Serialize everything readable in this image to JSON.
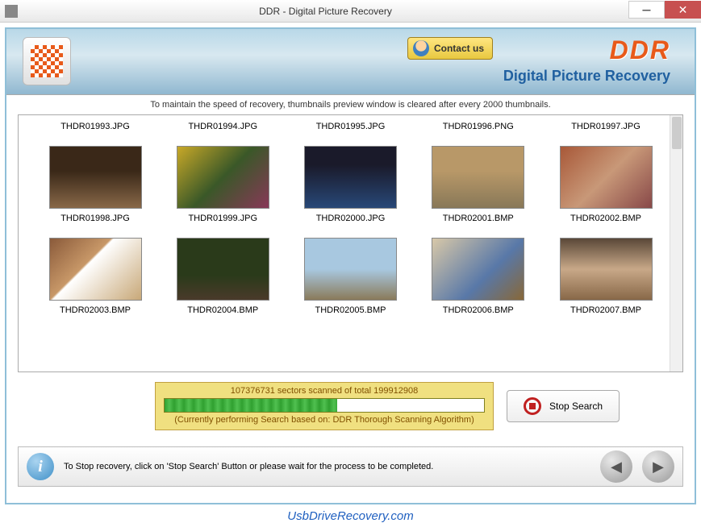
{
  "titlebar": {
    "title": "DDR - Digital Picture Recovery"
  },
  "header": {
    "contact_label": "Contact us",
    "brand": "DDR",
    "subtitle": "Digital Picture Recovery"
  },
  "notice": "To maintain the speed of recovery, thumbnails preview window is cleared after every 2000 thumbnails.",
  "thumbs": {
    "row0": [
      {
        "label": "THDR01993.JPG"
      },
      {
        "label": "THDR01994.JPG"
      },
      {
        "label": "THDR01995.JPG"
      },
      {
        "label": "THDR01996.PNG"
      },
      {
        "label": "THDR01997.JPG"
      }
    ],
    "row1": [
      {
        "label": "THDR01998.JPG"
      },
      {
        "label": "THDR01999.JPG"
      },
      {
        "label": "THDR02000.JPG"
      },
      {
        "label": "THDR02001.BMP"
      },
      {
        "label": "THDR02002.BMP"
      }
    ],
    "row2": [
      {
        "label": "THDR02003.BMP"
      },
      {
        "label": "THDR02004.BMP"
      },
      {
        "label": "THDR02005.BMP"
      },
      {
        "label": "THDR02006.BMP"
      },
      {
        "label": "THDR02007.BMP"
      }
    ]
  },
  "progress": {
    "text": "107376731 sectors scanned of total 199912908",
    "subtext": "(Currently performing Search based on:  DDR Thorough Scanning Algorithm)",
    "percent": 54
  },
  "stop_label": "Stop Search",
  "footer": {
    "tip": "To Stop recovery, click on 'Stop Search' Button or please wait for the process to be completed."
  },
  "watermark": "UsbDriveRecovery.com"
}
